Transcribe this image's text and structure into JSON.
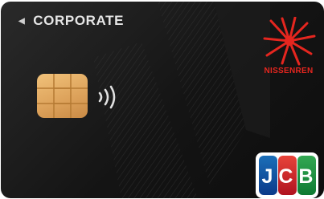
{
  "card": {
    "label": "CORPORATE",
    "brand": {
      "issuer": "NISSENREN",
      "network_letters": [
        "J",
        "C",
        "B"
      ]
    },
    "colors": {
      "card_body": "#141414",
      "text": "#e6e6e6",
      "accent_red": "#e5261f",
      "chip_gold": "#dca15a"
    },
    "icons": [
      "back-triangle-icon",
      "chip-icon",
      "contactless-icon",
      "starburst-logo-icon",
      "jcb-logo"
    ]
  }
}
